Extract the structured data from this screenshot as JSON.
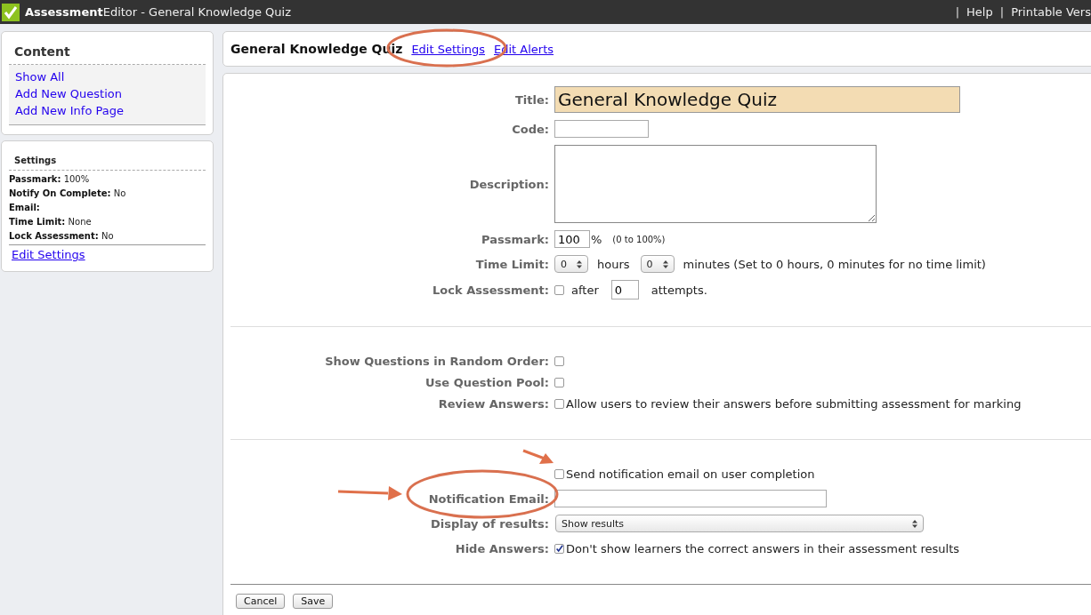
{
  "topbar": {
    "brand_bold": "Assessment",
    "brand_rest": "Editor - General Knowledge Quiz",
    "links": [
      {
        "separator": "|",
        "label": "Help"
      },
      {
        "separator": "|",
        "label": "Printable Vers"
      }
    ]
  },
  "sidebar": {
    "content": {
      "title": "Content",
      "links": [
        "Show All",
        "Add New Question",
        "Add New Info Page"
      ]
    },
    "settings": {
      "title": "Settings",
      "items": [
        {
          "label": "Passmark:",
          "value": "100%"
        },
        {
          "label": "Notify On Complete:",
          "value": "No"
        },
        {
          "label": "Email:"
        },
        {
          "label": "Time Limit:",
          "value": "None"
        },
        {
          "label": "Lock Assessment:",
          "value": "No"
        }
      ],
      "link": "Edit Settings"
    }
  },
  "header": {
    "title": "General Knowledge Quiz",
    "links": [
      "Edit Settings",
      "Edit Alerts"
    ]
  },
  "form": {
    "sections": [
      {
        "rows": [
          {
            "kind": "large_text",
            "label": "Title:",
            "value": "General Knowledge Quiz"
          },
          {
            "kind": "text",
            "label": "Code:"
          },
          {
            "kind": "textarea",
            "label": "Description:"
          },
          {
            "kind": "passmark",
            "label": "Passmark:",
            "value": "100",
            "unit": "%",
            "hint": "(0 to 100%)"
          },
          {
            "kind": "time_limit",
            "label": "Time Limit:",
            "hours": "0",
            "hours_label": "hours",
            "minutes": "0",
            "minutes_label": "minutes (Set to 0 hours, 0 minutes for no time limit)"
          },
          {
            "kind": "lock",
            "label": "Lock Assessment:",
            "checked": false,
            "before": "after",
            "value": "0",
            "after": "attempts."
          }
        ]
      },
      {
        "rows": [
          {
            "kind": "checkbox",
            "label": "Show Questions in Random Order:",
            "checked": false
          },
          {
            "kind": "checkbox",
            "label": "Use Question Pool:",
            "checked": false
          },
          {
            "kind": "checkbox",
            "label": "Review Answers:",
            "checked": false,
            "text": "Allow users to review their answers before submitting assessment for marking"
          }
        ]
      },
      {
        "rows": [
          {
            "kind": "checkbox",
            "checked": false,
            "text": "Send notification email on user completion"
          },
          {
            "kind": "email",
            "label": "Notification Email:"
          },
          {
            "kind": "select",
            "label": "Display of results:",
            "value": "Show results"
          },
          {
            "kind": "checkbox",
            "label": "Hide Answers:",
            "checked": true,
            "text": "Don't show learners the correct answers in their assessment results"
          }
        ]
      }
    ],
    "buttons": [
      "Cancel",
      "Save"
    ]
  }
}
